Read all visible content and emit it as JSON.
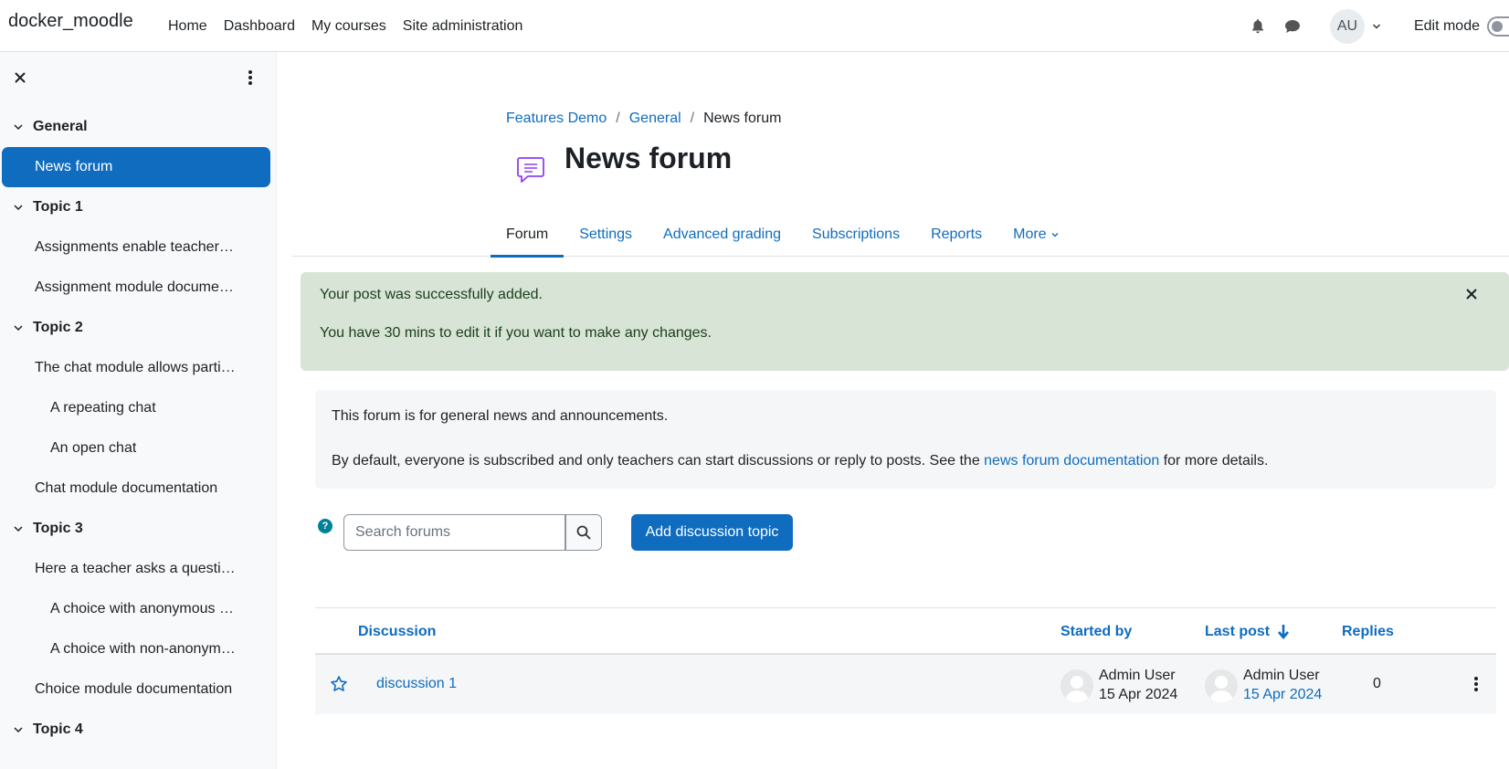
{
  "navbar": {
    "brand": "docker_moodle",
    "links": [
      "Home",
      "Dashboard",
      "My courses",
      "Site administration"
    ],
    "user_initials": "AU",
    "edit_mode_label": "Edit mode"
  },
  "drawer": {
    "sections": [
      {
        "title": "General",
        "items": [
          {
            "label": "News forum",
            "active": true
          }
        ]
      },
      {
        "title": "Topic 1",
        "items": [
          {
            "label": "Assignments enable teachers to grade and comment on uploaded files"
          },
          {
            "label": "Assignment module documentation"
          }
        ]
      },
      {
        "title": "Topic 2",
        "items": [
          {
            "label": "The chat module allows participants to have a real-time conversation"
          },
          {
            "label": "A repeating chat",
            "indent": true
          },
          {
            "label": "An open chat",
            "indent": true
          },
          {
            "label": "Chat module documentation"
          }
        ]
      },
      {
        "title": "Topic 3",
        "items": [
          {
            "label": "Here a teacher asks a question and specifies a choice of multiple responses"
          },
          {
            "label": "A choice with anonymous results",
            "indent": true
          },
          {
            "label": "A choice with non-anonymous results",
            "indent": true
          },
          {
            "label": "Choice module documentation"
          }
        ]
      },
      {
        "title": "Topic 4",
        "items": []
      }
    ]
  },
  "breadcrumb": [
    "Features Demo",
    "General",
    "News forum"
  ],
  "page_title": "News forum",
  "tabs": [
    "Forum",
    "Settings",
    "Advanced grading",
    "Subscriptions",
    "Reports",
    "More"
  ],
  "alert": {
    "line1": "Your post was successfully added.",
    "line2": "You have 30 mins to edit it if you want to make any changes."
  },
  "intro": {
    "p1": "This forum is for general news and announcements.",
    "p2_before": "By default, everyone is subscribed and only teachers can start discussions or reply to posts. See the ",
    "p2_link": "news forum documentation",
    "p2_after": " for more details."
  },
  "search": {
    "placeholder": "Search forums"
  },
  "add_button": "Add discussion topic",
  "table": {
    "headers": {
      "discussion": "Discussion",
      "started_by": "Started by",
      "last_post": "Last post",
      "replies": "Replies"
    },
    "rows": [
      {
        "title": "discussion 1",
        "started_by_name": "Admin User",
        "started_by_date": "15 Apr 2024",
        "last_post_name": "Admin User",
        "last_post_date": "15 Apr 2024",
        "replies": "0"
      }
    ]
  },
  "colors": {
    "primary": "#0f6cbf",
    "success_bg": "#d7e4d6",
    "drawer_bg": "#f8f9fa"
  }
}
